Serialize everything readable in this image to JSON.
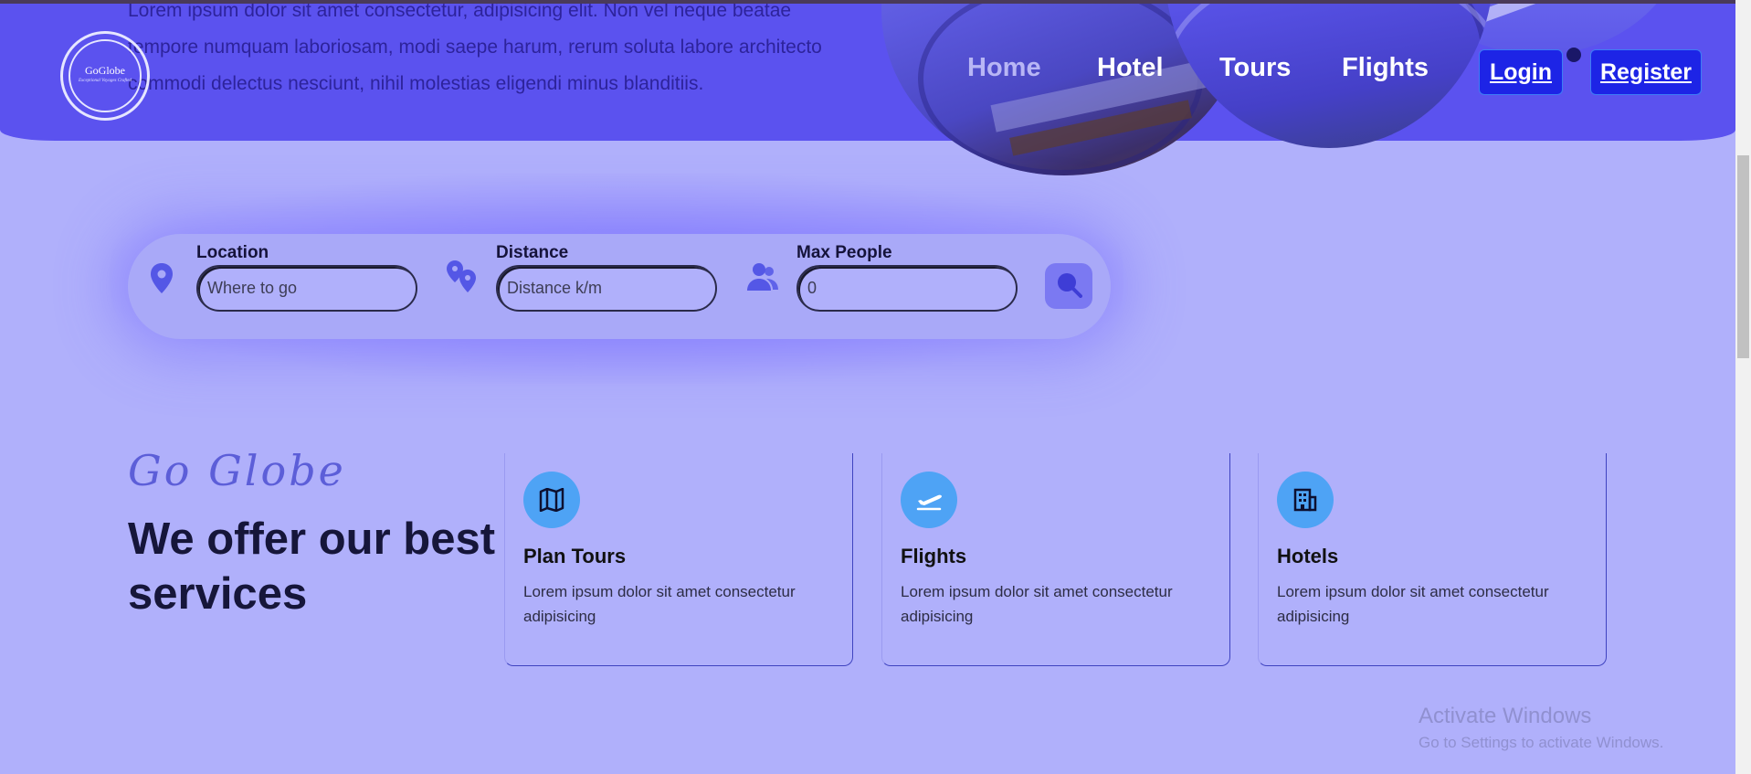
{
  "hero": {
    "text": "Lorem ipsum dolor sit amet consectetur, adipisicing elit. Non vel neque beatae tempore numquam laboriosam, modi saepe harum, rerum soluta labore architecto commodi delectus nesciunt, nihil molestias eligendi minus blanditiis."
  },
  "logo": {
    "name": "GoGlobe",
    "tagline": "Exceptional Voyages Crafted"
  },
  "nav": {
    "items": [
      {
        "label": "Home",
        "active": true
      },
      {
        "label": "Hotel"
      },
      {
        "label": "Tours"
      },
      {
        "label": "Flights"
      }
    ],
    "login": "Login",
    "register": "Register"
  },
  "search": {
    "location": {
      "label": "Location",
      "placeholder": "Where to go",
      "icon": "map-pin-icon"
    },
    "distance": {
      "label": "Distance",
      "placeholder": "Distance k/m",
      "icon": "map-pins-icon"
    },
    "people": {
      "label": "Max People",
      "placeholder": "0",
      "icon": "users-icon"
    },
    "button_icon": "search-icon"
  },
  "services": {
    "tagline": "Go Globe",
    "heading": "We offer our best services",
    "cards": [
      {
        "title": "Plan Tours",
        "desc": "Lorem ipsum dolor sit amet consectetur adipisicing",
        "icon": "map-icon"
      },
      {
        "title": "Flights",
        "desc": "Lorem ipsum dolor sit amet consectetur adipisicing",
        "icon": "plane-departure-icon"
      },
      {
        "title": "Hotels",
        "desc": "Lorem ipsum dolor sit amet consectetur adipisicing",
        "icon": "building-icon"
      }
    ]
  },
  "watermark": {
    "title": "Activate Windows",
    "subtitle": "Go to Settings to activate Windows."
  },
  "colors": {
    "hero": "#5b52ef",
    "page": "#b0b0fb",
    "accent": "#1d24e6",
    "card_icon": "#4ea3f5"
  }
}
